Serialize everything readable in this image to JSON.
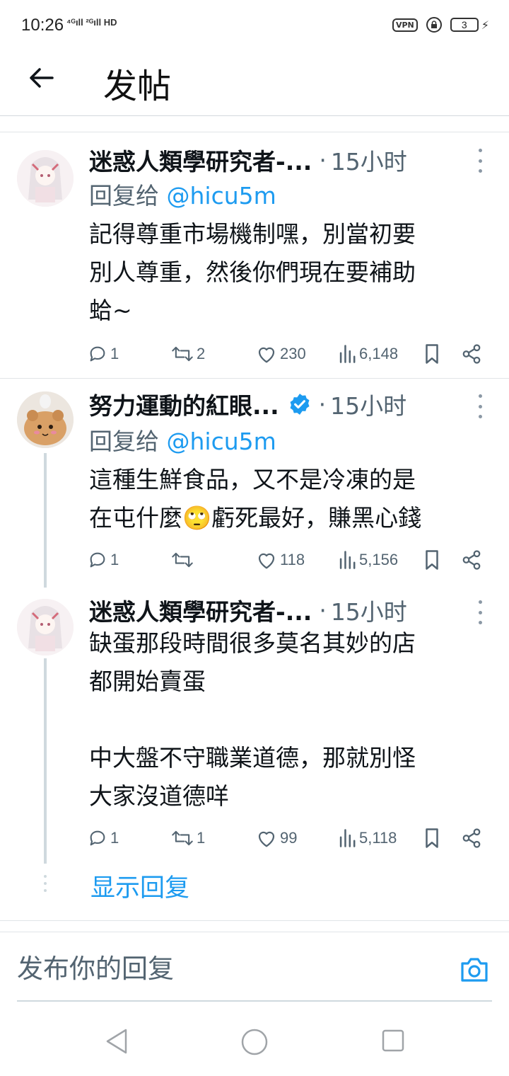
{
  "status_bar": {
    "time": "10:26",
    "network": "⁴ᴳıll ²ᴳıll HD",
    "vpn": "VPN",
    "battery": "3"
  },
  "header": {
    "title": "发帖"
  },
  "tweets": [
    {
      "author": "迷惑人類學研究者-...",
      "time": "15小时",
      "reply_prefix": "回复给",
      "reply_handle": "@hicu5m",
      "text": "記得尊重市場機制嘿，別當初要\n別人尊重，然後你們現在要補助\n蛤~",
      "replies": "1",
      "retweets": "2",
      "likes": "230",
      "views": "6,148",
      "verified": false
    },
    {
      "author": "努力運動的紅眼...",
      "time": "15小时",
      "reply_prefix": "回复给",
      "reply_handle": "@hicu5m",
      "text": "這種生鮮食品，又不是冷凍的是\n在屯什麼🙄虧死最好，賺黑心錢",
      "replies": "1",
      "retweets": "",
      "likes": "118",
      "views": "5,156",
      "verified": true
    },
    {
      "author": "迷惑人類學研究者-...",
      "time": "15小时",
      "text": "缺蛋那段時間很多莫名其妙的店\n都開始賣蛋\n\n中大盤不守職業道德，那就別怪\n大家沒道德咩",
      "replies": "1",
      "retweets": "1",
      "likes": "99",
      "views": "5,118",
      "verified": false
    }
  ],
  "show_replies": "显示回复",
  "composer": {
    "placeholder": "发布你的回复"
  },
  "colors": {
    "accent": "#1d9bf0",
    "secondary_text": "#536471",
    "primary_text": "#0f1419"
  }
}
